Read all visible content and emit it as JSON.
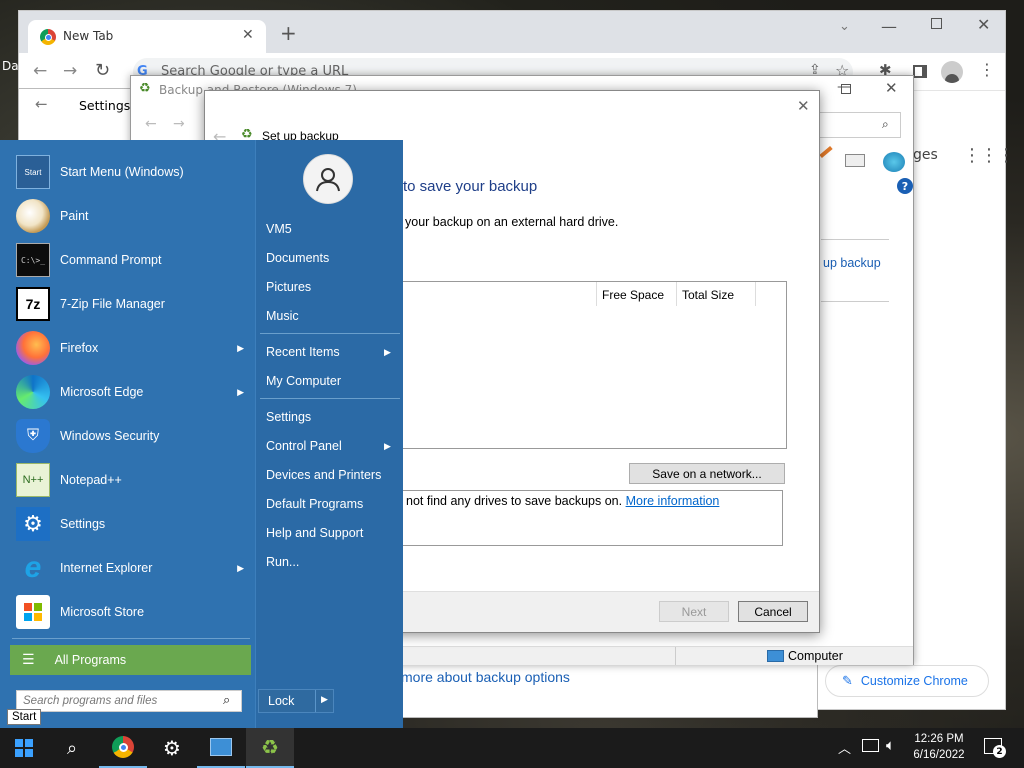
{
  "desktop": {
    "partial_label": "Da"
  },
  "chrome": {
    "tab_title": "New Tab",
    "omnibox_placeholder": "Search Google or type a URL",
    "images_partial": "ges",
    "customize_label": "Customize Chrome"
  },
  "settings_window": {
    "title": "Settings"
  },
  "backup_window": {
    "title": "Backup and Restore (Windows 7)",
    "side_link": "up backup",
    "learn_more": "more about backup options",
    "status_computer": "Computer"
  },
  "wizard": {
    "title": "Set up backup",
    "heading": "to save your backup",
    "subtext": "your backup on an external hard drive.",
    "columns": [
      "Free Space",
      "Total Size"
    ],
    "save_network": "Save on a network...",
    "info_text": "not find any drives to save backups on.",
    "info_link": "More information",
    "next": "Next",
    "cancel": "Cancel"
  },
  "start_menu": {
    "programs": [
      {
        "label": "Start Menu (Windows)",
        "icon": "start-menu-icon",
        "arrow": false
      },
      {
        "label": "Paint",
        "icon": "paint-icon",
        "arrow": false
      },
      {
        "label": "Command Prompt",
        "icon": "cmd-icon",
        "arrow": false
      },
      {
        "label": "7-Zip File Manager",
        "icon": "7zip-icon",
        "arrow": false
      },
      {
        "label": "Firefox",
        "icon": "firefox-icon",
        "arrow": true
      },
      {
        "label": "Microsoft Edge",
        "icon": "edge-icon",
        "arrow": true
      },
      {
        "label": "Windows Security",
        "icon": "shield-icon",
        "arrow": false
      },
      {
        "label": "Notepad++",
        "icon": "notepadpp-icon",
        "arrow": false
      },
      {
        "label": "Settings",
        "icon": "gear-icon",
        "arrow": false
      },
      {
        "label": "Internet Explorer",
        "icon": "ie-icon",
        "arrow": true
      },
      {
        "label": "Microsoft Store",
        "icon": "store-icon",
        "arrow": false
      }
    ],
    "all_programs": "All Programs",
    "search_placeholder": "Search programs and files",
    "right_items": [
      {
        "label": "VM5",
        "arrow": false
      },
      {
        "label": "Documents",
        "arrow": false
      },
      {
        "label": "Pictures",
        "arrow": false
      },
      {
        "label": "Music",
        "arrow": false
      },
      {
        "label": "Recent Items",
        "arrow": true
      },
      {
        "label": "My Computer",
        "arrow": false
      },
      {
        "label": "Settings",
        "arrow": false
      },
      {
        "label": "Control Panel",
        "arrow": true
      },
      {
        "label": "Devices and Printers",
        "arrow": false
      },
      {
        "label": "Default Programs",
        "arrow": false
      },
      {
        "label": "Help and Support",
        "arrow": false
      },
      {
        "label": "Run...",
        "arrow": false
      }
    ],
    "lock": "Lock",
    "start_tooltip": "Start",
    "start_icon_text": "Start"
  },
  "taskbar": {
    "time": "12:26 PM",
    "date": "6/16/2022",
    "notification_count": "2"
  },
  "colors": {
    "start_bg": "#2f72b0",
    "all_programs_bg": "#6aa84f",
    "taskbar": "#1b1b1b"
  }
}
